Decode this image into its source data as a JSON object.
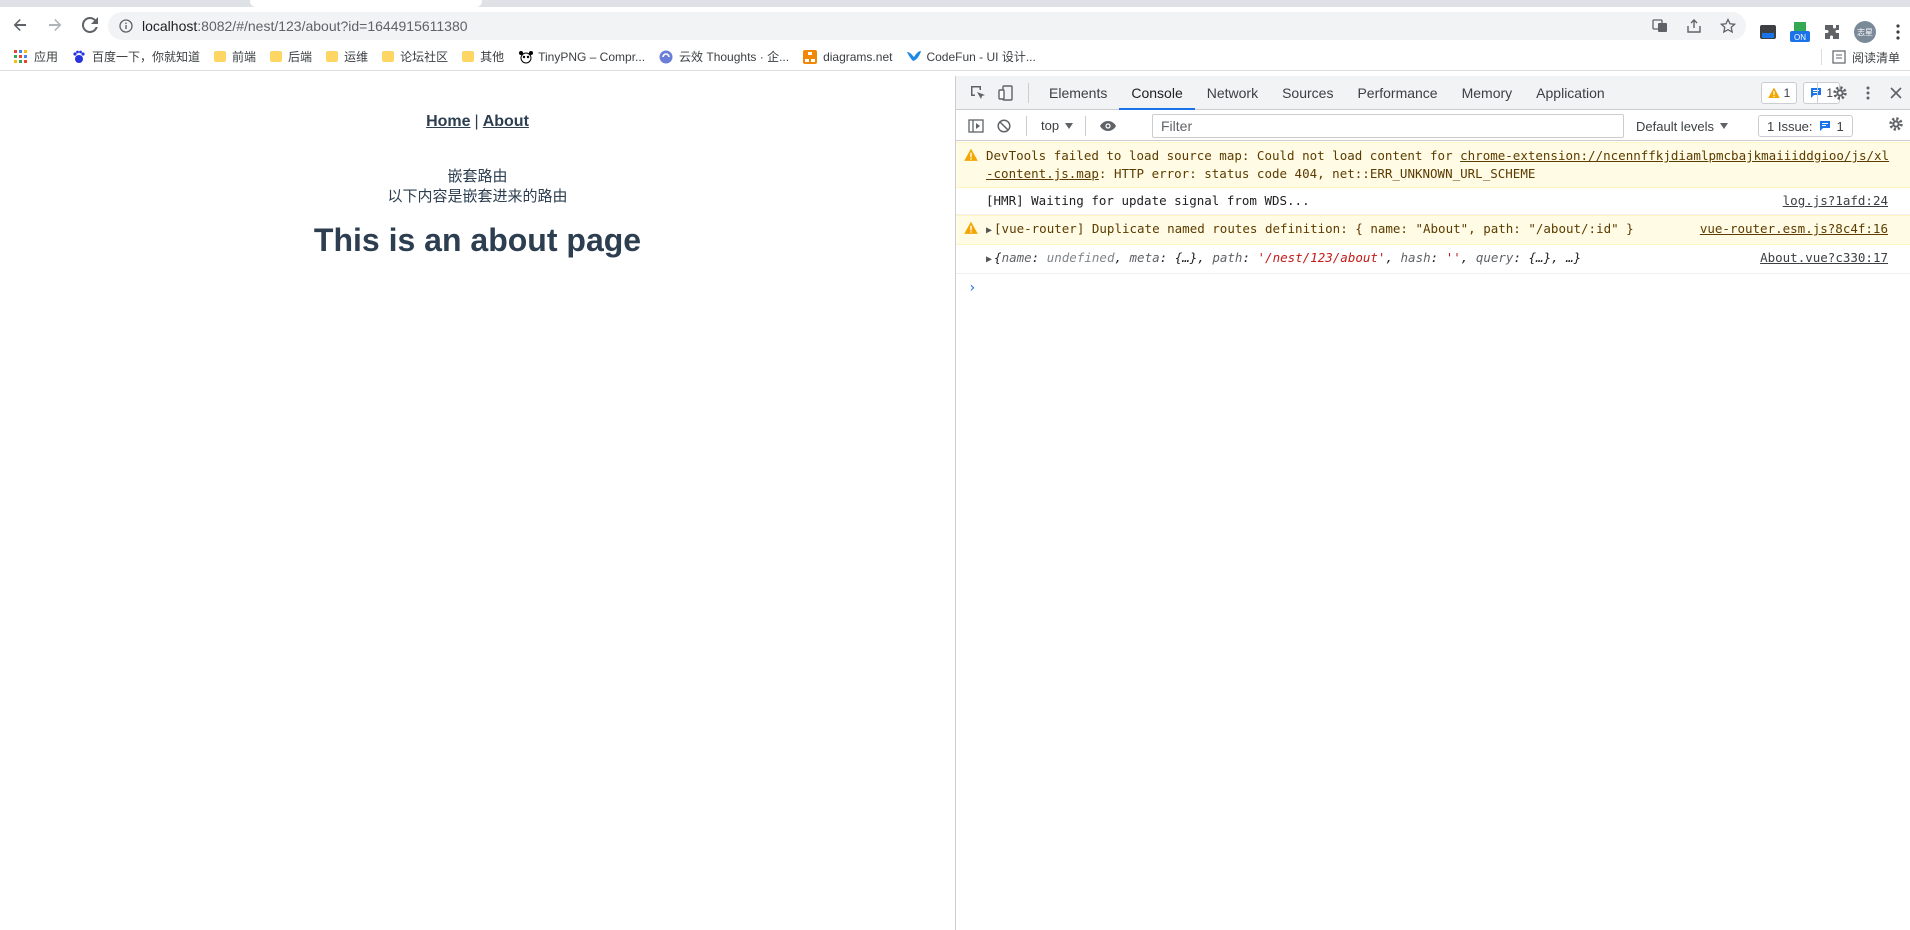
{
  "browser": {
    "url_host": "localhost",
    "url_rest": ":8082/#/nest/123/about?id=1644915611380",
    "bookmarks": [
      {
        "label": "应用",
        "icon": "apps-grid-icon"
      },
      {
        "label": "百度一下，你就知道",
        "icon": "baidu-paw-icon"
      },
      {
        "label": "前端",
        "icon": "folder-icon"
      },
      {
        "label": "后端",
        "icon": "folder-icon"
      },
      {
        "label": "运维",
        "icon": "folder-icon"
      },
      {
        "label": "论坛社区",
        "icon": "folder-icon"
      },
      {
        "label": "其他",
        "icon": "folder-icon"
      },
      {
        "label": "TinyPNG – Compr...",
        "icon": "panda-icon"
      },
      {
        "label": "云效 Thoughts · 企...",
        "icon": "yunxiao-icon"
      },
      {
        "label": "diagrams.net",
        "icon": "diagrams-icon"
      },
      {
        "label": "CodeFun - UI 设计...",
        "icon": "codefun-bird-icon"
      }
    ],
    "reading_list": "阅读清单",
    "avatar_text": "志星",
    "ext_badge": "ON"
  },
  "page": {
    "nav_home": "Home",
    "nav_divider": "|",
    "nav_about": "About",
    "nested_title": "嵌套路由",
    "nested_sub": "以下内容是嵌套进来的路由",
    "heading": "This is an about page"
  },
  "devtools": {
    "tabs": [
      "Elements",
      "Console",
      "Network",
      "Sources",
      "Performance",
      "Memory",
      "Application"
    ],
    "active_tab": "Console",
    "warn_count": "1",
    "info_count": "1",
    "context": "top",
    "filter_placeholder": "Filter",
    "levels": "Default levels",
    "issues_label": "1 Issue:",
    "issues_count": "1",
    "messages": {
      "m1_text_a": "DevTools failed to load source map: Could not load content for ",
      "m1_link": "chrome-extension://ncennffkjdiamlpmcbajkmaiiiddgioo/js/xl-content.js.map",
      "m1_text_b": ": HTTP error: status code 404, net::ERR_UNKNOWN_URL_SCHEME",
      "m2_text": "[HMR] Waiting for update signal from WDS...",
      "m2_src": "log.js?1afd:24",
      "m3_text": "[vue-router] Duplicate named routes definition: { name: \"About\", path: \"/about/:id\" }",
      "m3_src": "vue-router.esm.js?8c4f:16",
      "m4_k1": "name",
      "m4_v1": "undefined",
      "m4_k2": "meta",
      "m4_v2": "{…}",
      "m4_k3": "path",
      "m4_v3": "'/nest/123/about'",
      "m4_k4": "hash",
      "m4_v4": "''",
      "m4_k5": "query",
      "m4_v5": "{…}",
      "m4_tail": "…}",
      "m4_src": "About.vue?c330:17"
    },
    "prompt": "›"
  },
  "colors": {
    "accent": "#1a73e8",
    "warn_bg": "#fffbe5",
    "page_text": "#2c3e50"
  }
}
